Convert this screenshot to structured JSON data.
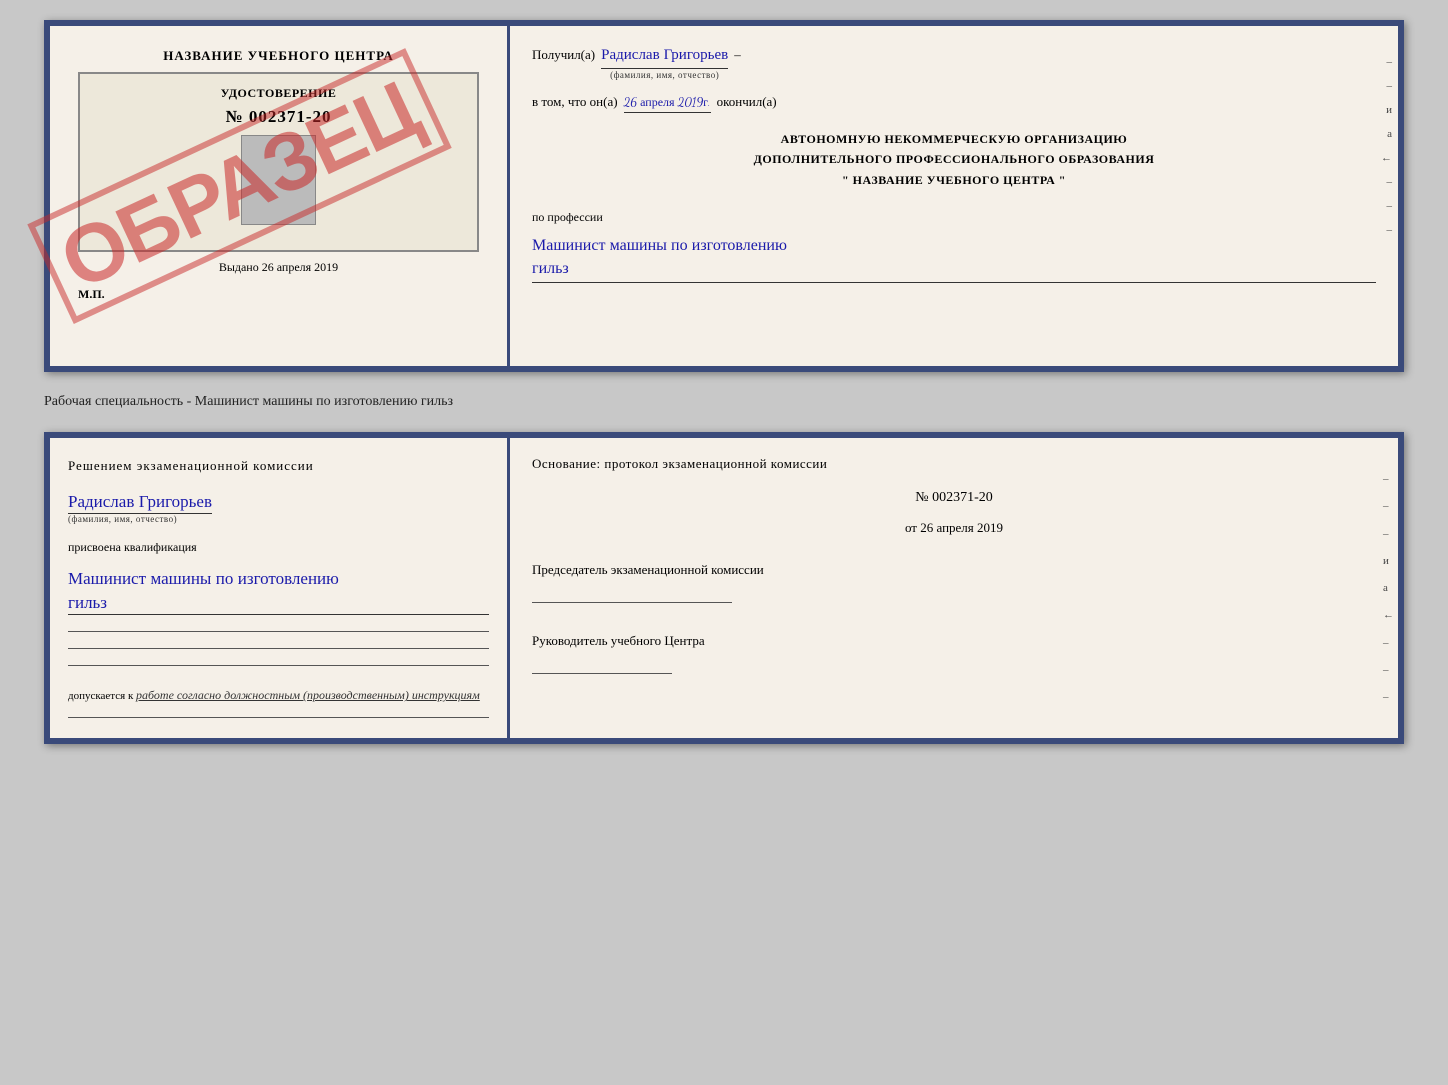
{
  "top_doc": {
    "left": {
      "title": "НАЗВАНИЕ УЧЕБНОГО ЦЕНТРА",
      "stamp": "ОБРАЗЕЦ",
      "cert_inner_title": "УДОСТОВЕРЕНИЕ",
      "cert_number": "№ 002371-20",
      "issued_label": "Выдано",
      "issued_date": "26 апреля 2019",
      "mp_label": "М.П."
    },
    "right": {
      "received_prefix": "Получил(а)",
      "fio": "Радислав Григорьев",
      "fio_sub": "(фамилия, имя, отчество)",
      "in_that_prefix": "в том, что он(а)",
      "date_value": "26 апреля 2019г.",
      "finished_label": "окончил(а)",
      "org_line1": "АВТОНОМНУЮ НЕКОММЕРЧЕСКУЮ ОРГАНИЗАЦИЮ",
      "org_line2": "ДОПОЛНИТЕЛЬНОГО ПРОФЕССИОНАЛЬНОГО ОБРАЗОВАНИЯ",
      "org_line3": "\"  НАЗВАНИЕ УЧЕБНОГО ЦЕНТРА  \"",
      "profession_label": "по профессии",
      "profession_value": "Машинист машины по изготовлению",
      "profession_value2": "гильз",
      "right_marks": [
        "–",
        "–",
        "и",
        "а",
        "←",
        "–",
        "–",
        "–"
      ]
    }
  },
  "label": "Рабочая специальность - Машинист машины по изготовлению гильз",
  "bottom_doc": {
    "left": {
      "decision_title": "Решением  экзаменационной  комиссии",
      "fio": "Радислав Григорьев",
      "fio_sub": "(фамилия, имя, отчество)",
      "qualification_label": "присвоена квалификация",
      "qualification_value": "Машинист машины по изготовлению",
      "qualification_value2": "гильз",
      "допуск_prefix": "допускается к",
      "допуск_value": "работе согласно должностным (производственным) инструкциям"
    },
    "right": {
      "basis_label": "Основание: протокол экзаменационной  комиссии",
      "number_label": "№",
      "number_value": "002371-20",
      "date_prefix": "от",
      "date_value": "26 апреля 2019",
      "chairman_label": "Председатель экзаменационной комиссии",
      "head_label": "Руководитель учебного Центра",
      "right_marks": [
        "–",
        "–",
        "–",
        "и",
        "а",
        "←",
        "–",
        "–",
        "–"
      ]
    }
  }
}
